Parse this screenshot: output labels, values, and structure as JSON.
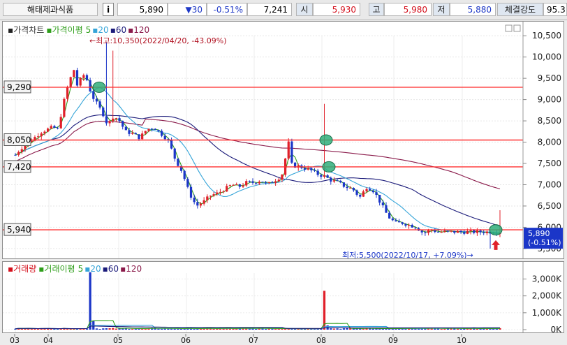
{
  "header": {
    "stock_name": "해태제과식품",
    "info_button": "i",
    "price": "5,890",
    "change": "▼30",
    "change_rate": "-0.51%",
    "volume": "7,241",
    "open_label": "시",
    "open": "5,930",
    "high_label": "고",
    "high": "5,980",
    "low_label": "저",
    "low": "5,880",
    "strength_label": "체결강도",
    "strength": "95.3"
  },
  "price_panel": {
    "legend": {
      "price": "가격차트",
      "ma_label": "가격이평",
      "ma5": "5",
      "ma20": "20",
      "ma60": "60",
      "ma120": "120"
    },
    "high_note": "←최고:10,350(2022/04/20, -43.09%)",
    "low_note": "최저:5,500(2022/10/17, +7.09%)→",
    "h_lines": [
      "9,290",
      "8,050",
      "7,420",
      "5,940"
    ],
    "current_price": "5,890",
    "current_rate": "(-0.51%)"
  },
  "volume_panel": {
    "legend": {
      "volume": "거래량",
      "ma_label": "거래이평",
      "ma5": "5",
      "ma20": "20",
      "ma60": "60",
      "ma120": "120"
    }
  },
  "months": [
    "03",
    "04",
    "05",
    "06",
    "07",
    "08",
    "09",
    "10"
  ],
  "colors": {
    "up": "#e0202a",
    "down": "#1b36c8",
    "ma5": "#2e9e1a",
    "ma20": "#35a4d8",
    "ma60": "#1b1b7a",
    "ma120": "#8a1a4a",
    "hline": "#ff3030"
  },
  "chart_data": [
    {
      "type": "candlestick",
      "title": "가격차트",
      "y_ticks": [
        "10,500",
        "10,000",
        "9,500",
        "9,000",
        "8,500",
        "8,000",
        "7,500",
        "7,000",
        "6,500",
        "6,000",
        "5,500"
      ],
      "ylim": [
        5400,
        10700
      ],
      "x_ticks": [
        "03",
        "04",
        "05",
        "06",
        "07",
        "08",
        "09",
        "10"
      ],
      "horizontal_lines": [
        9290,
        8050,
        7420,
        5940
      ],
      "highest": {
        "value": 10350,
        "date": "2022/04/20"
      },
      "lowest": {
        "value": 5500,
        "date": "2022/10/17"
      },
      "series": [
        {
          "name": "가격차트",
          "type": "close",
          "x": [
            0,
            3,
            6,
            9,
            12,
            15,
            18,
            21,
            24,
            27,
            30,
            33,
            35,
            38,
            40,
            43,
            46,
            49,
            52,
            55,
            58,
            62,
            66,
            70,
            74,
            78,
            82,
            86,
            90,
            94,
            98,
            102,
            106,
            110,
            114,
            118,
            122,
            126,
            130,
            134,
            138,
            142,
            146,
            150,
            154,
            156,
            158,
            162,
            166,
            170,
            174,
            178,
            182,
            186,
            190,
            194,
            198,
            202,
            206,
            210,
            214,
            218,
            222,
            226,
            230,
            234,
            238,
            242,
            246,
            250,
            254,
            258,
            262,
            266,
            270,
            273
          ],
          "values": [
            7700,
            7850,
            7950,
            8050,
            8150,
            8250,
            8300,
            8350,
            8300,
            8900,
            9400,
            9700,
            9300,
            9600,
            9500,
            9100,
            8900,
            8700,
            8400,
            8600,
            8550,
            8250,
            8200,
            8100,
            8300,
            8350,
            8200,
            8050,
            7600,
            7300,
            6800,
            6500,
            6600,
            6750,
            6800,
            6900,
            7000,
            6950,
            7050,
            7050,
            7100,
            7000,
            7100,
            7200,
            8000,
            7400,
            7450,
            7400,
            7350,
            7250,
            7200,
            7100,
            7050,
            6950,
            6900,
            6700,
            6950,
            6850,
            6550,
            6250,
            6100,
            6100,
            6050,
            6000,
            5850,
            5950,
            5890,
            5890,
            5890,
            5890,
            5890,
            5890,
            5890,
            5890,
            5890,
            5890
          ]
        },
        {
          "name": "5",
          "values": []
        },
        {
          "name": "20",
          "values": []
        },
        {
          "name": "60",
          "values": []
        },
        {
          "name": "120",
          "values": []
        }
      ]
    },
    {
      "type": "bar",
      "title": "거래량",
      "y_ticks": [
        "3,000K",
        "2,000K",
        "1,000K",
        "0K"
      ],
      "ylim": [
        0,
        3600000
      ],
      "spikes": [
        {
          "month": "04",
          "value": 3400000
        },
        {
          "month": "08",
          "value": 2300000
        }
      ]
    }
  ]
}
